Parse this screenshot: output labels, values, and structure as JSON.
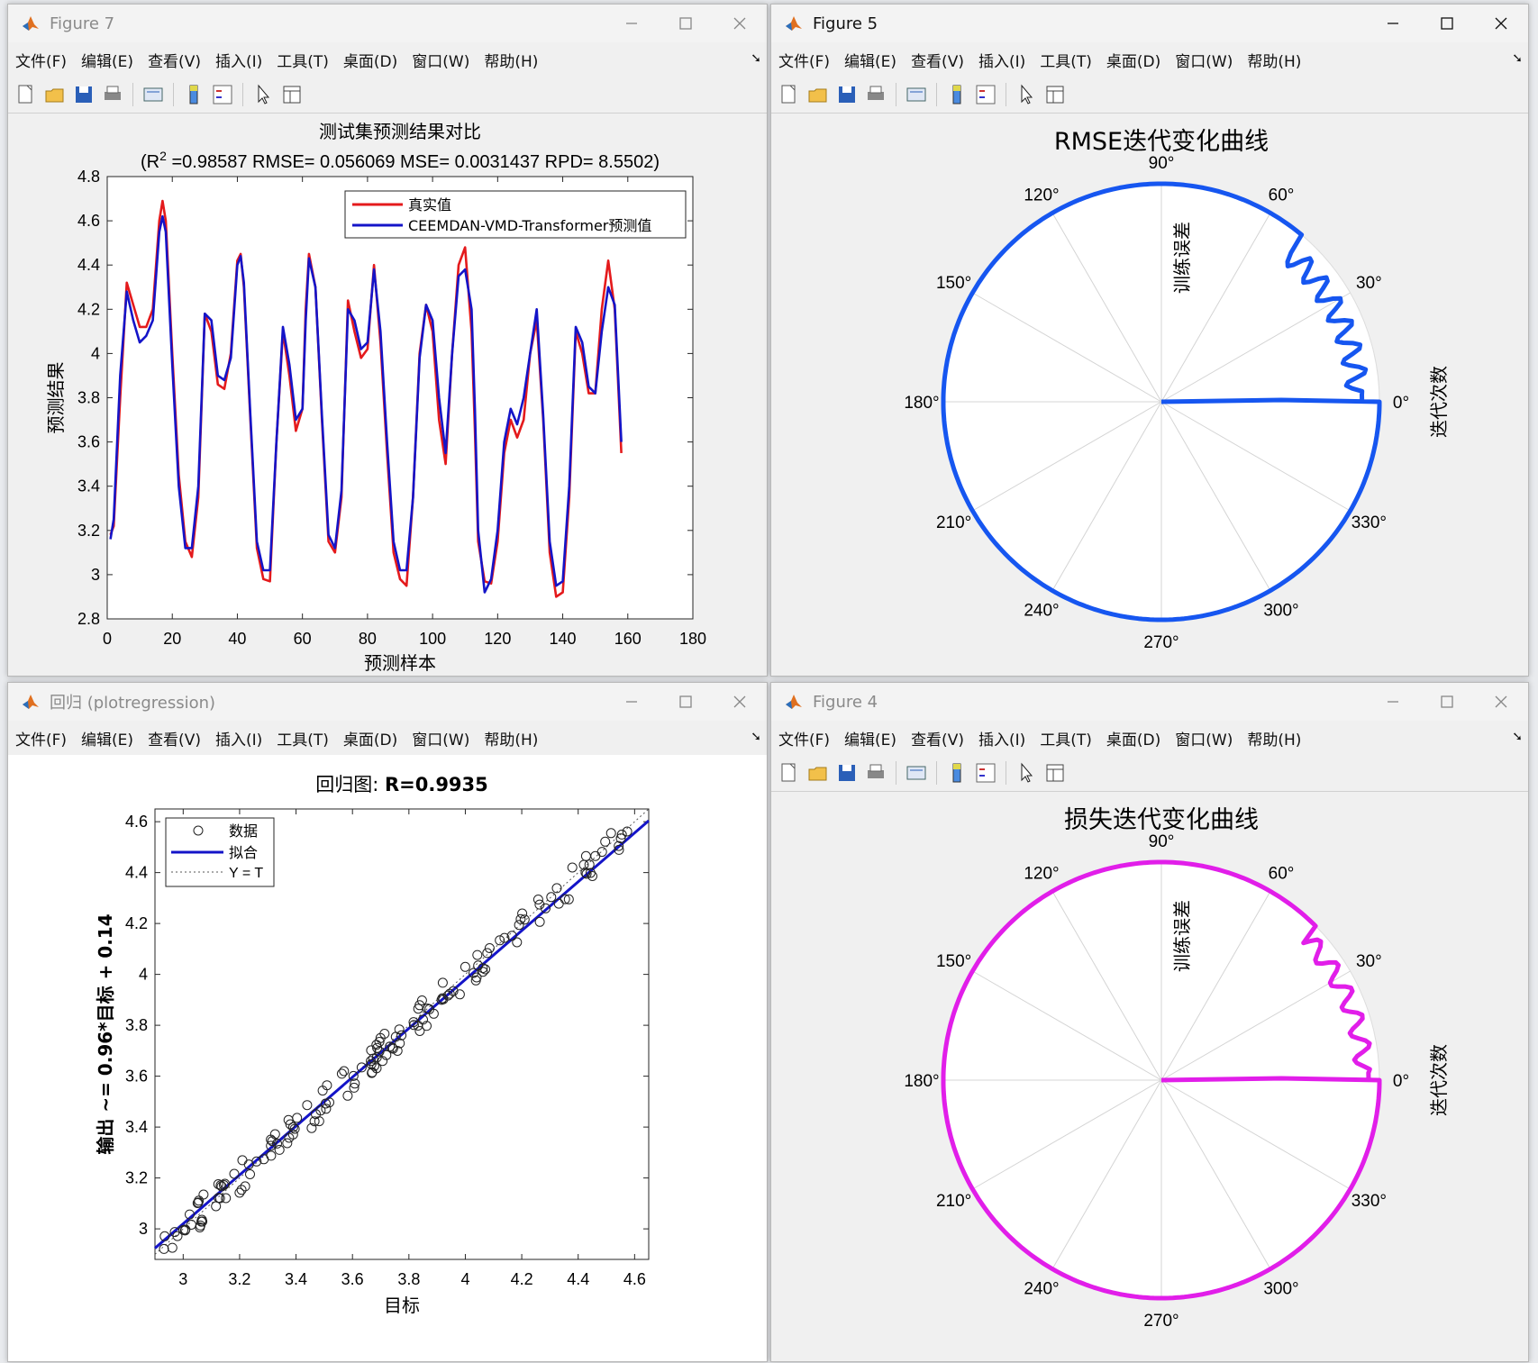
{
  "menu": [
    "文件(F)",
    "编辑(E)",
    "查看(V)",
    "插入(I)",
    "工具(T)",
    "桌面(D)",
    "窗口(W)",
    "帮助(H)"
  ],
  "colors": {
    "real": "#e41a1c",
    "pred": "#1414c8",
    "rmse": "#1656f0",
    "loss": "#e11ee9",
    "fit": "#1414c8"
  },
  "fig7": {
    "window_title": "Figure 7",
    "chart_data": {
      "type": "line",
      "title": "测试集预测结果对比",
      "subtitle": "(R^2 =0.98587 RMSE= 0.056069 MSE= 0.0031437 RPD= 8.5502)",
      "xlabel": "预测样本",
      "ylabel": "预测结果",
      "xlim": [
        0,
        180
      ],
      "ylim": [
        2.8,
        4.8
      ],
      "xticks": [
        0,
        20,
        40,
        60,
        80,
        100,
        120,
        140,
        160,
        180
      ],
      "yticks": [
        2.8,
        3,
        3.2,
        3.4,
        3.6,
        3.8,
        4,
        4.2,
        4.4,
        4.6,
        4.8
      ],
      "legend": "top-right",
      "series": [
        {
          "name": "真实值",
          "x": [
            1,
            2,
            4,
            6,
            8,
            10,
            12,
            14,
            16,
            17,
            18,
            20,
            22,
            24,
            26,
            28,
            30,
            32,
            34,
            36,
            38,
            40,
            41,
            42,
            44,
            46,
            48,
            50,
            52,
            54,
            56,
            58,
            60,
            61,
            62,
            64,
            66,
            68,
            70,
            72,
            74,
            76,
            78,
            80,
            82,
            84,
            86,
            88,
            90,
            92,
            94,
            96,
            98,
            100,
            102,
            104,
            106,
            108,
            110,
            112,
            113,
            114,
            116,
            118,
            120,
            122,
            124,
            126,
            128,
            130,
            132,
            134,
            136,
            138,
            140,
            142,
            144,
            146,
            148,
            150,
            152,
            154,
            156,
            158,
            160,
            162,
            165
          ],
          "y": [
            3.18,
            3.22,
            3.8,
            4.32,
            4.22,
            4.12,
            4.12,
            4.2,
            4.6,
            4.69,
            4.6,
            4.0,
            3.45,
            3.15,
            3.08,
            3.35,
            4.18,
            4.1,
            3.86,
            3.84,
            4.0,
            4.42,
            4.45,
            4.3,
            3.7,
            3.12,
            2.98,
            2.97,
            3.6,
            4.1,
            3.9,
            3.65,
            3.75,
            4.2,
            4.45,
            4.3,
            3.7,
            3.15,
            3.1,
            3.35,
            4.24,
            4.1,
            3.98,
            4.02,
            4.4,
            4.05,
            3.55,
            3.1,
            2.98,
            2.95,
            3.35,
            4.0,
            4.22,
            4.1,
            3.7,
            3.5,
            4.0,
            4.4,
            4.48,
            4.1,
            3.65,
            3.15,
            2.97,
            2.96,
            3.15,
            3.55,
            3.7,
            3.62,
            3.7,
            4.0,
            4.15,
            3.7,
            3.1,
            2.9,
            2.92,
            3.35,
            4.1,
            4.0,
            3.82,
            3.82,
            4.2,
            4.42,
            4.2,
            3.55
          ],
          "note_count": 84
        },
        {
          "name": "CEEMDAN-VMD-Transformer预测值",
          "x": [
            1,
            2,
            4,
            6,
            8,
            10,
            12,
            14,
            16,
            17,
            18,
            20,
            22,
            24,
            26,
            28,
            30,
            32,
            34,
            36,
            38,
            40,
            41,
            42,
            44,
            46,
            48,
            50,
            52,
            54,
            56,
            58,
            60,
            61,
            62,
            64,
            66,
            68,
            70,
            72,
            74,
            76,
            78,
            80,
            82,
            84,
            86,
            88,
            90,
            92,
            94,
            96,
            98,
            100,
            102,
            104,
            106,
            108,
            110,
            112,
            113,
            114,
            116,
            118,
            120,
            122,
            124,
            126,
            128,
            130,
            132,
            134,
            136,
            138,
            140,
            142,
            144,
            146,
            148,
            150,
            152,
            154,
            156,
            158,
            160,
            162,
            165
          ],
          "y": [
            3.16,
            3.25,
            3.9,
            4.28,
            4.15,
            4.05,
            4.08,
            4.15,
            4.55,
            4.62,
            4.55,
            3.95,
            3.4,
            3.12,
            3.12,
            3.4,
            4.18,
            4.15,
            3.9,
            3.88,
            3.98,
            4.4,
            4.44,
            4.32,
            3.72,
            3.15,
            3.02,
            3.02,
            3.6,
            4.12,
            3.95,
            3.7,
            3.75,
            4.15,
            4.43,
            4.3,
            3.72,
            3.18,
            3.12,
            3.38,
            4.2,
            4.15,
            4.02,
            4.05,
            4.38,
            4.1,
            3.6,
            3.15,
            3.02,
            3.02,
            3.35,
            3.98,
            4.22,
            4.15,
            3.8,
            3.55,
            4.0,
            4.35,
            4.38,
            4.2,
            3.75,
            3.2,
            2.92,
            2.98,
            3.2,
            3.6,
            3.75,
            3.68,
            3.8,
            4.0,
            4.2,
            3.72,
            3.15,
            2.95,
            2.97,
            3.4,
            4.12,
            4.05,
            3.85,
            3.82,
            4.1,
            4.3,
            4.22,
            3.6
          ]
        }
      ]
    }
  },
  "fig5": {
    "window_title": "Figure 5",
    "chart_data": {
      "type": "polar-line",
      "title": "RMSE迭代变化曲线",
      "theta_label": "训练误差",
      "r_label": "迭代次数",
      "angle_ticks": [
        "90°",
        "60°",
        "30°",
        "0°",
        "330°",
        "300°",
        "270°",
        "240°",
        "210°",
        "180°",
        "150°",
        "120°"
      ],
      "series": [
        {
          "name": "",
          "color": "#1656f0"
        }
      ]
    }
  },
  "fig4": {
    "window_title": "Figure 4",
    "chart_data": {
      "type": "polar-line",
      "title": "损失迭代变化曲线",
      "theta_label": "训练误差",
      "r_label": "迭代次数",
      "angle_ticks": [
        "90°",
        "60°",
        "30°",
        "0°",
        "330°",
        "300°",
        "270°",
        "240°",
        "210°",
        "180°",
        "150°",
        "120°"
      ],
      "series": [
        {
          "name": "",
          "color": "#e11ee9"
        }
      ]
    }
  },
  "regr": {
    "window_title": "回归 (plotregression)",
    "chart_data": {
      "type": "scatter",
      "title": "回归图: R=0.9935",
      "title_prefix": "回归图: ",
      "title_bold": "R=0.9935",
      "xlabel": "目标",
      "ylabel": "输出 ~= 0.96*目标 + 0.14",
      "xlim": [
        2.9,
        4.65
      ],
      "ylim": [
        2.88,
        4.65
      ],
      "xticks": [
        3,
        3.2,
        3.4,
        3.6,
        3.8,
        4,
        4.2,
        4.4,
        4.6
      ],
      "yticks": [
        3,
        3.2,
        3.4,
        3.6,
        3.8,
        4,
        4.2,
        4.4,
        4.6
      ],
      "legend": [
        "数据",
        "拟合",
        "Y = T"
      ],
      "fit": {
        "slope": 0.96,
        "intercept": 0.14
      }
    }
  }
}
